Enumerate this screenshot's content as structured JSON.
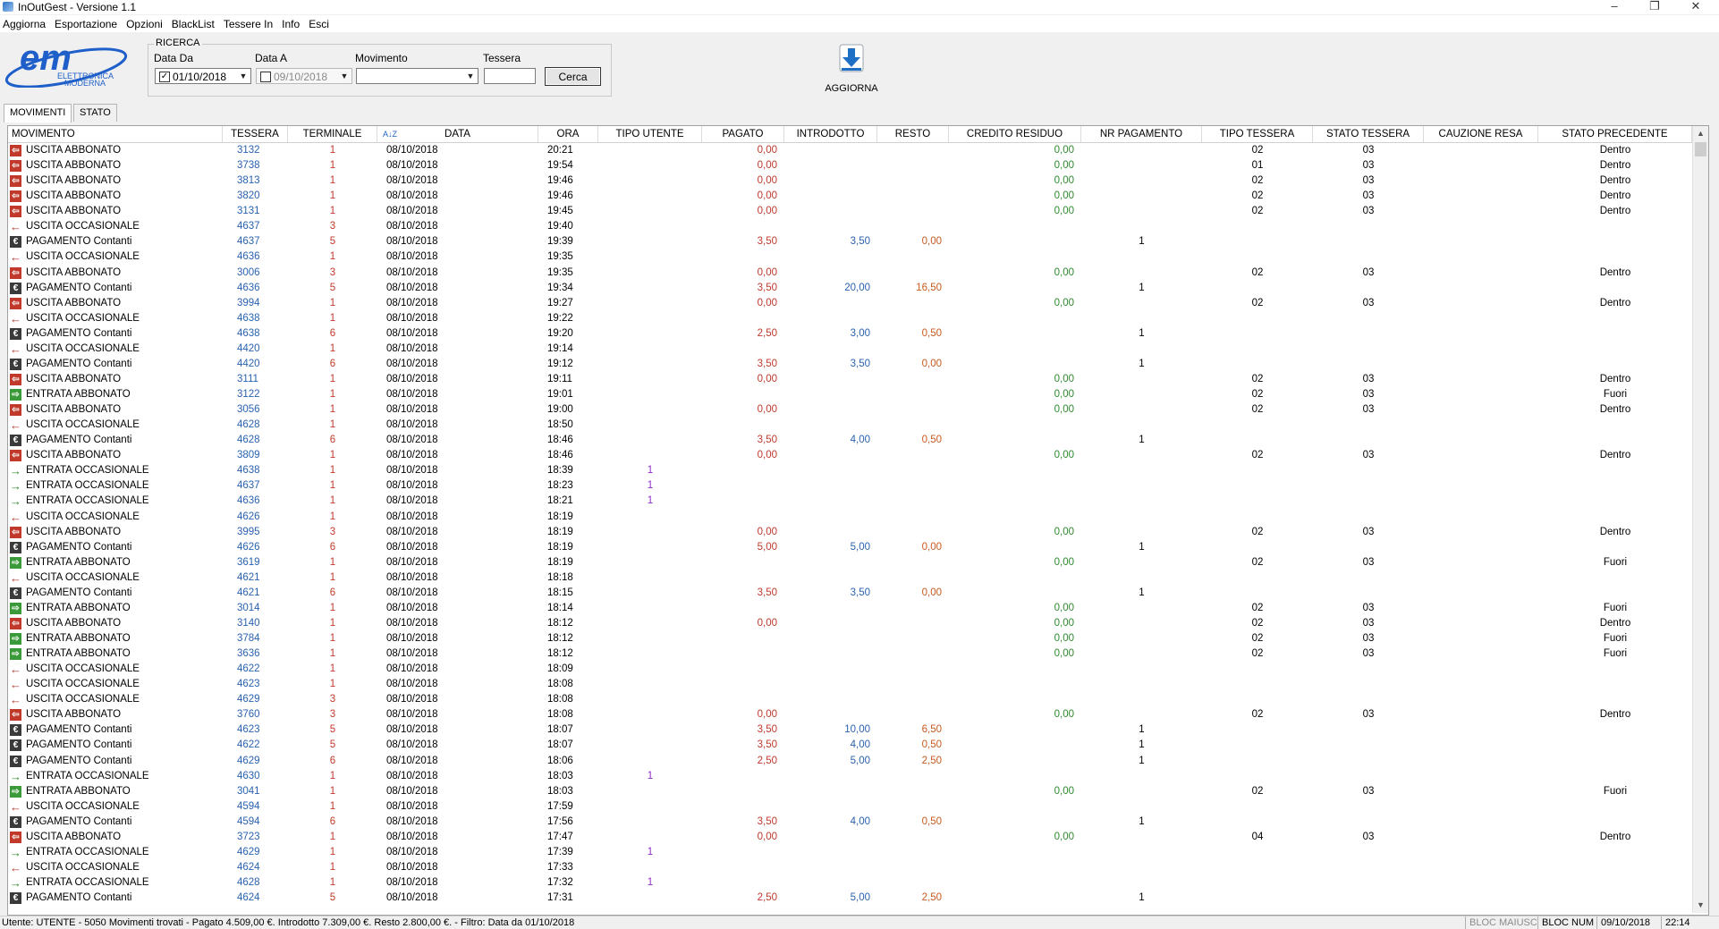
{
  "window": {
    "title": "InOutGest - Versione 1.1",
    "controls": [
      "–",
      "❐",
      "✕"
    ]
  },
  "menu": [
    "Aggiorna",
    "Esportazione",
    "Opzioni",
    "BlackList",
    "Tessere In",
    "Info",
    "Esci"
  ],
  "logo": {
    "line1": "ELETTRONICA",
    "line2": "MODERNA",
    "brand_color": "#1f5fc9"
  },
  "search": {
    "legend": "RICERCA",
    "data_da_label": "Data Da",
    "data_da_value": "01/10/2018",
    "data_da_checked": "✓",
    "data_a_label": "Data A",
    "data_a_value": "09/10/2018",
    "data_a_checked": "",
    "movimento_label": "Movimento",
    "movimento_value": "",
    "tessera_label": "Tessera",
    "tessera_value": "",
    "cerca_label": "Cerca"
  },
  "toolbar": {
    "aggiorna_label": "AGGIORNA",
    "aggiorna_icon": "download-icon"
  },
  "tabs": [
    "MOVIMENTI",
    "STATO"
  ],
  "columns": [
    "MOVIMENTO",
    "TESSERA",
    "TERMINALE",
    "DATA",
    "ORA",
    "TIPO UTENTE",
    "PAGATO",
    "INTRODOTTO",
    "RESTO",
    "CREDITO RESIDUO",
    "NR PAGAMENTO",
    "TIPO TESSERA",
    "STATO TESSERA",
    "CAUZIONE RESA",
    "STATO PRECEDENTE"
  ],
  "sort_indicator": "A↓Z",
  "rows": [
    [
      "USCITA ABBONATO",
      "3132",
      "1",
      "08/10/2018",
      "20:21",
      "",
      "0,00",
      "",
      "",
      "0,00",
      "",
      "02",
      "03",
      "",
      "Dentro"
    ],
    [
      "USCITA ABBONATO",
      "3738",
      "1",
      "08/10/2018",
      "19:54",
      "",
      "0,00",
      "",
      "",
      "0,00",
      "",
      "01",
      "03",
      "",
      "Dentro"
    ],
    [
      "USCITA ABBONATO",
      "3813",
      "1",
      "08/10/2018",
      "19:46",
      "",
      "0,00",
      "",
      "",
      "0,00",
      "",
      "02",
      "03",
      "",
      "Dentro"
    ],
    [
      "USCITA ABBONATO",
      "3820",
      "1",
      "08/10/2018",
      "19:46",
      "",
      "0,00",
      "",
      "",
      "0,00",
      "",
      "02",
      "03",
      "",
      "Dentro"
    ],
    [
      "USCITA ABBONATO",
      "3131",
      "1",
      "08/10/2018",
      "19:45",
      "",
      "0,00",
      "",
      "",
      "0,00",
      "",
      "02",
      "03",
      "",
      "Dentro"
    ],
    [
      "USCITA OCCASIONALE",
      "4637",
      "3",
      "08/10/2018",
      "19:40",
      "",
      "",
      "",
      "",
      "",
      "",
      "",
      "",
      "",
      ""
    ],
    [
      "PAGAMENTO Contanti",
      "4637",
      "5",
      "08/10/2018",
      "19:39",
      "",
      "3,50",
      "3,50",
      "0,00",
      "",
      "1",
      "",
      "",
      "",
      ""
    ],
    [
      "USCITA OCCASIONALE",
      "4636",
      "1",
      "08/10/2018",
      "19:35",
      "",
      "",
      "",
      "",
      "",
      "",
      "",
      "",
      "",
      ""
    ],
    [
      "USCITA ABBONATO",
      "3006",
      "3",
      "08/10/2018",
      "19:35",
      "",
      "0,00",
      "",
      "",
      "0,00",
      "",
      "02",
      "03",
      "",
      "Dentro"
    ],
    [
      "PAGAMENTO Contanti",
      "4636",
      "5",
      "08/10/2018",
      "19:34",
      "",
      "3,50",
      "20,00",
      "16,50",
      "",
      "1",
      "",
      "",
      "",
      ""
    ],
    [
      "USCITA ABBONATO",
      "3994",
      "1",
      "08/10/2018",
      "19:27",
      "",
      "0,00",
      "",
      "",
      "0,00",
      "",
      "02",
      "03",
      "",
      "Dentro"
    ],
    [
      "USCITA OCCASIONALE",
      "4638",
      "1",
      "08/10/2018",
      "19:22",
      "",
      "",
      "",
      "",
      "",
      "",
      "",
      "",
      "",
      ""
    ],
    [
      "PAGAMENTO Contanti",
      "4638",
      "6",
      "08/10/2018",
      "19:20",
      "",
      "2,50",
      "3,00",
      "0,50",
      "",
      "1",
      "",
      "",
      "",
      ""
    ],
    [
      "USCITA OCCASIONALE",
      "4420",
      "1",
      "08/10/2018",
      "19:14",
      "",
      "",
      "",
      "",
      "",
      "",
      "",
      "",
      "",
      ""
    ],
    [
      "PAGAMENTO Contanti",
      "4420",
      "6",
      "08/10/2018",
      "19:12",
      "",
      "3,50",
      "3,50",
      "0,00",
      "",
      "1",
      "",
      "",
      "",
      ""
    ],
    [
      "USCITA ABBONATO",
      "3111",
      "1",
      "08/10/2018",
      "19:11",
      "",
      "0,00",
      "",
      "",
      "0,00",
      "",
      "02",
      "03",
      "",
      "Dentro"
    ],
    [
      "ENTRATA ABBONATO",
      "3122",
      "1",
      "08/10/2018",
      "19:01",
      "",
      "",
      "",
      "",
      "0,00",
      "",
      "02",
      "03",
      "",
      "Fuori"
    ],
    [
      "USCITA ABBONATO",
      "3056",
      "1",
      "08/10/2018",
      "19:00",
      "",
      "0,00",
      "",
      "",
      "0,00",
      "",
      "02",
      "03",
      "",
      "Dentro"
    ],
    [
      "USCITA OCCASIONALE",
      "4628",
      "1",
      "08/10/2018",
      "18:50",
      "",
      "",
      "",
      "",
      "",
      "",
      "",
      "",
      "",
      ""
    ],
    [
      "PAGAMENTO Contanti",
      "4628",
      "6",
      "08/10/2018",
      "18:46",
      "",
      "3,50",
      "4,00",
      "0,50",
      "",
      "1",
      "",
      "",
      "",
      ""
    ],
    [
      "USCITA ABBONATO",
      "3809",
      "1",
      "08/10/2018",
      "18:46",
      "",
      "0,00",
      "",
      "",
      "0,00",
      "",
      "02",
      "03",
      "",
      "Dentro"
    ],
    [
      "ENTRATA OCCASIONALE",
      "4638",
      "1",
      "08/10/2018",
      "18:39",
      "1",
      "",
      "",
      "",
      "",
      "",
      "",
      "",
      "",
      ""
    ],
    [
      "ENTRATA OCCASIONALE",
      "4637",
      "1",
      "08/10/2018",
      "18:23",
      "1",
      "",
      "",
      "",
      "",
      "",
      "",
      "",
      "",
      ""
    ],
    [
      "ENTRATA OCCASIONALE",
      "4636",
      "1",
      "08/10/2018",
      "18:21",
      "1",
      "",
      "",
      "",
      "",
      "",
      "",
      "",
      "",
      ""
    ],
    [
      "USCITA OCCASIONALE",
      "4626",
      "1",
      "08/10/2018",
      "18:19",
      "",
      "",
      "",
      "",
      "",
      "",
      "",
      "",
      "",
      ""
    ],
    [
      "USCITA ABBONATO",
      "3995",
      "3",
      "08/10/2018",
      "18:19",
      "",
      "0,00",
      "",
      "",
      "0,00",
      "",
      "02",
      "03",
      "",
      "Dentro"
    ],
    [
      "PAGAMENTO Contanti",
      "4626",
      "6",
      "08/10/2018",
      "18:19",
      "",
      "5,00",
      "5,00",
      "0,00",
      "",
      "1",
      "",
      "",
      "",
      ""
    ],
    [
      "ENTRATA ABBONATO",
      "3619",
      "1",
      "08/10/2018",
      "18:19",
      "",
      "",
      "",
      "",
      "0,00",
      "",
      "02",
      "03",
      "",
      "Fuori"
    ],
    [
      "USCITA OCCASIONALE",
      "4621",
      "1",
      "08/10/2018",
      "18:18",
      "",
      "",
      "",
      "",
      "",
      "",
      "",
      "",
      "",
      ""
    ],
    [
      "PAGAMENTO Contanti",
      "4621",
      "6",
      "08/10/2018",
      "18:15",
      "",
      "3,50",
      "3,50",
      "0,00",
      "",
      "1",
      "",
      "",
      "",
      ""
    ],
    [
      "ENTRATA ABBONATO",
      "3014",
      "1",
      "08/10/2018",
      "18:14",
      "",
      "",
      "",
      "",
      "0,00",
      "",
      "02",
      "03",
      "",
      "Fuori"
    ],
    [
      "USCITA ABBONATO",
      "3140",
      "1",
      "08/10/2018",
      "18:12",
      "",
      "0,00",
      "",
      "",
      "0,00",
      "",
      "02",
      "03",
      "",
      "Dentro"
    ],
    [
      "ENTRATA ABBONATO",
      "3784",
      "1",
      "08/10/2018",
      "18:12",
      "",
      "",
      "",
      "",
      "0,00",
      "",
      "02",
      "03",
      "",
      "Fuori"
    ],
    [
      "ENTRATA ABBONATO",
      "3636",
      "1",
      "08/10/2018",
      "18:12",
      "",
      "",
      "",
      "",
      "0,00",
      "",
      "02",
      "03",
      "",
      "Fuori"
    ],
    [
      "USCITA OCCASIONALE",
      "4622",
      "1",
      "08/10/2018",
      "18:09",
      "",
      "",
      "",
      "",
      "",
      "",
      "",
      "",
      "",
      ""
    ],
    [
      "USCITA OCCASIONALE",
      "4623",
      "1",
      "08/10/2018",
      "18:08",
      "",
      "",
      "",
      "",
      "",
      "",
      "",
      "",
      "",
      ""
    ],
    [
      "USCITA OCCASIONALE",
      "4629",
      "3",
      "08/10/2018",
      "18:08",
      "",
      "",
      "",
      "",
      "",
      "",
      "",
      "",
      "",
      ""
    ],
    [
      "USCITA ABBONATO",
      "3760",
      "3",
      "08/10/2018",
      "18:08",
      "",
      "0,00",
      "",
      "",
      "0,00",
      "",
      "02",
      "03",
      "",
      "Dentro"
    ],
    [
      "PAGAMENTO Contanti",
      "4623",
      "5",
      "08/10/2018",
      "18:07",
      "",
      "3,50",
      "10,00",
      "6,50",
      "",
      "1",
      "",
      "",
      "",
      ""
    ],
    [
      "PAGAMENTO Contanti",
      "4622",
      "5",
      "08/10/2018",
      "18:07",
      "",
      "3,50",
      "4,00",
      "0,50",
      "",
      "1",
      "",
      "",
      "",
      ""
    ],
    [
      "PAGAMENTO Contanti",
      "4629",
      "6",
      "08/10/2018",
      "18:06",
      "",
      "2,50",
      "5,00",
      "2,50",
      "",
      "1",
      "",
      "",
      "",
      ""
    ],
    [
      "ENTRATA OCCASIONALE",
      "4630",
      "1",
      "08/10/2018",
      "18:03",
      "1",
      "",
      "",
      "",
      "",
      "",
      "",
      "",
      "",
      ""
    ],
    [
      "ENTRATA ABBONATO",
      "3041",
      "1",
      "08/10/2018",
      "18:03",
      "",
      "",
      "",
      "",
      "0,00",
      "",
      "02",
      "03",
      "",
      "Fuori"
    ],
    [
      "USCITA OCCASIONALE",
      "4594",
      "1",
      "08/10/2018",
      "17:59",
      "",
      "",
      "",
      "",
      "",
      "",
      "",
      "",
      "",
      ""
    ],
    [
      "PAGAMENTO Contanti",
      "4594",
      "6",
      "08/10/2018",
      "17:56",
      "",
      "3,50",
      "4,00",
      "0,50",
      "",
      "1",
      "",
      "",
      "",
      ""
    ],
    [
      "USCITA ABBONATO",
      "3723",
      "1",
      "08/10/2018",
      "17:47",
      "",
      "0,00",
      "",
      "",
      "0,00",
      "",
      "04",
      "03",
      "",
      "Dentro"
    ],
    [
      "ENTRATA OCCASIONALE",
      "4629",
      "1",
      "08/10/2018",
      "17:39",
      "1",
      "",
      "",
      "",
      "",
      "",
      "",
      "",
      "",
      ""
    ],
    [
      "USCITA OCCASIONALE",
      "4624",
      "1",
      "08/10/2018",
      "17:33",
      "",
      "",
      "",
      "",
      "",
      "",
      "",
      "",
      "",
      ""
    ],
    [
      "ENTRATA OCCASIONALE",
      "4628",
      "1",
      "08/10/2018",
      "17:32",
      "1",
      "",
      "",
      "",
      "",
      "",
      "",
      "",
      "",
      ""
    ],
    [
      "PAGAMENTO Contanti",
      "4624",
      "5",
      "08/10/2018",
      "17:31",
      "",
      "2,50",
      "5,00",
      "2,50",
      "",
      "1",
      "",
      "",
      "",
      ""
    ]
  ],
  "status": {
    "main": "Utente: UTENTE - 5050 Movimenti trovati - Pagato 4.509,00 €. Introdotto 7.309,00 €. Resto 2.800,00 €. - Filtro: Data da 01/10/2018",
    "caps": "BLOC MAIUSC",
    "num": "BLOC NUM",
    "date": "09/10/2018",
    "time": "22:14"
  },
  "colors": {
    "exit_icon": "#c0392b",
    "entry_icon": "#3a9a3a",
    "payment_icon": "#3a3a3a",
    "tessera_text": "#2a62b0",
    "terminale_text": "#c0392b",
    "pagato_text": "#c0392b",
    "introdotto_text": "#2a62b0",
    "resto_text": "#c85a20",
    "credito_text": "#2f8a2f",
    "tipo_utente_text": "#8e2bc7"
  }
}
